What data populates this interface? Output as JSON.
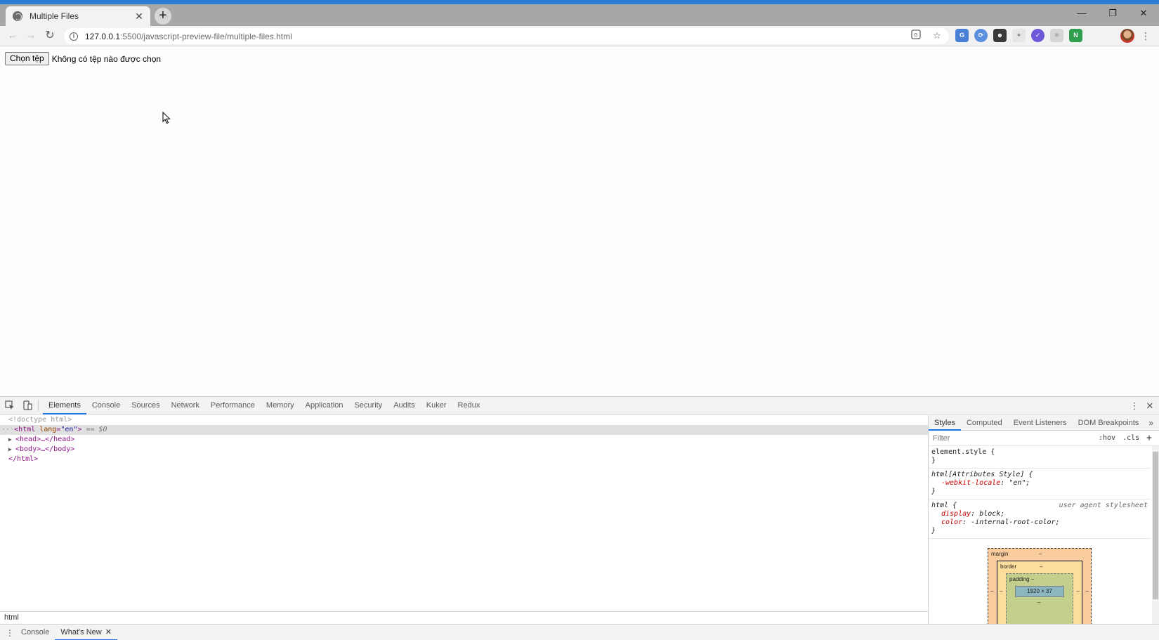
{
  "browser": {
    "tab_title": "Multiple Files",
    "tab_close": "✕",
    "new_tab": "+",
    "url_host": "127.0.0.1",
    "url_path": ":5500/javascript-preview-file/multiple-files.html",
    "window_controls": [
      "—",
      "❐",
      "✕"
    ]
  },
  "page": {
    "file_button": "Chọn tệp",
    "file_status": "Không có tệp nào được chọn"
  },
  "devtools": {
    "tabs": [
      "Elements",
      "Console",
      "Sources",
      "Network",
      "Performance",
      "Memory",
      "Application",
      "Security",
      "Audits",
      "Kuker",
      "Redux"
    ],
    "active_tab": "Elements",
    "dom": {
      "doctype": "<!doctype html>",
      "html_open_prefix": "···",
      "html_tag": "<html",
      "lang_attr": " lang",
      "lang_val": "\"en\"",
      "html_close_bracket": ">",
      "eq_marker": " == $0",
      "head": "<head>…</head>",
      "body": "<body>…</body>",
      "html_close": "</html>"
    },
    "breadcrumb": "html",
    "side_tabs": [
      "Styles",
      "Computed",
      "Event Listeners",
      "DOM Breakpoints"
    ],
    "side_more": "»",
    "filter_placeholder": "Filter",
    "hov": ":hov",
    "cls": ".cls",
    "plus": "+",
    "rules": {
      "element_style": "element.style {",
      "close": "}",
      "attr_selector": "html[Attributes Style] {",
      "locale_name": "-webkit-locale",
      "locale_value": ": \"en\";",
      "html_selector": "html {",
      "ua_label": "user agent stylesheet",
      "display_name": "display",
      "display_value": ": block;",
      "color_name": "color",
      "color_value": ": -internal-root-color;"
    },
    "box_model": {
      "margin_label": "margin",
      "border_label": "border",
      "padding_label": "padding –",
      "dash": "–",
      "content_size": "1920 × 37"
    },
    "drawer": {
      "kebab": "⋮",
      "tabs": [
        "Console",
        "What's New"
      ],
      "close": "✕"
    }
  }
}
